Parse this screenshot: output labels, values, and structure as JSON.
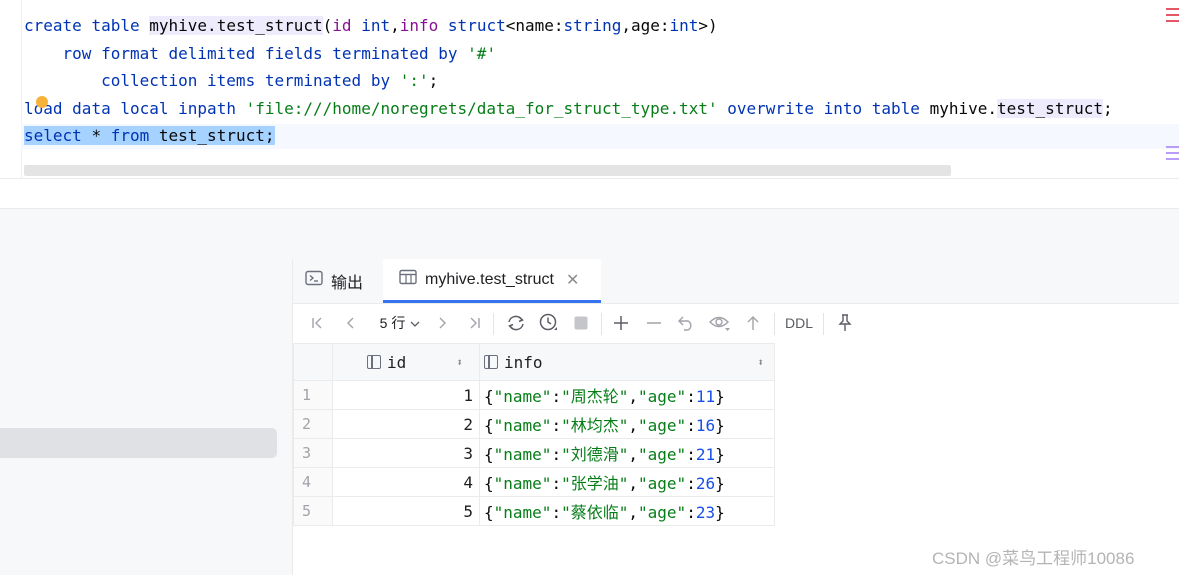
{
  "editor": {
    "line1": {
      "kw1": "create",
      "kw2": "table",
      "db": "myhive",
      "dot": ".",
      "tbl": "test_struct",
      "p1": "(",
      "c1": "id",
      "t1": "int",
      "comma1": ",",
      "c2": "info",
      "t2": "struct",
      "lt": "<",
      "f1": "name",
      "colon1": ":",
      "ft1": "string",
      "comma2": ",",
      "f2": "age",
      "colon2": ":",
      "ft2": "int",
      "gt": ">)"
    },
    "line2": {
      "k1": "row",
      "k2": "format",
      "k3": "delimited",
      "k4": "fields",
      "k5": "terminated",
      "k6": "by",
      "s": "'#'"
    },
    "line3": {
      "k1": "collection",
      "k2": "items",
      "k3": "terminated",
      "k4": "by",
      "s": "':'",
      "semi": ";"
    },
    "line4": {
      "k1": "load",
      "k2": "data",
      "k3": "local",
      "k4": "inpath",
      "s": "'file:///home/noregrets/data_for_struct_type.txt'",
      "k5": "overwrite",
      "k6": "into",
      "k7": "table",
      "db": "myhive",
      "dot": ".",
      "tbl": "test_struct",
      "semi": ";"
    },
    "line5": {
      "k1": "select",
      "star": "*",
      "k2": "from",
      "tbl": "test_struct",
      "semi": ";"
    }
  },
  "results": {
    "tabs": [
      {
        "label": "输出",
        "icon": "terminal-icon"
      },
      {
        "label": "myhive.test_struct",
        "icon": "table-icon",
        "close": "✕"
      }
    ],
    "toolbar": {
      "rows": "5 行",
      "ddl": "DDL"
    },
    "columns": [
      {
        "name": "id"
      },
      {
        "name": "info"
      }
    ],
    "rows": [
      {
        "num": "1",
        "id": "1",
        "name": "周杰轮",
        "age": "11"
      },
      {
        "num": "2",
        "id": "2",
        "name": "林均杰",
        "age": "16"
      },
      {
        "num": "3",
        "id": "3",
        "name": "刘德滑",
        "age": "21"
      },
      {
        "num": "4",
        "id": "4",
        "name": "张学油",
        "age": "26"
      },
      {
        "num": "5",
        "id": "5",
        "name": "蔡依临",
        "age": "23"
      }
    ]
  },
  "watermark": "CSDN @菜鸟工程师10086"
}
